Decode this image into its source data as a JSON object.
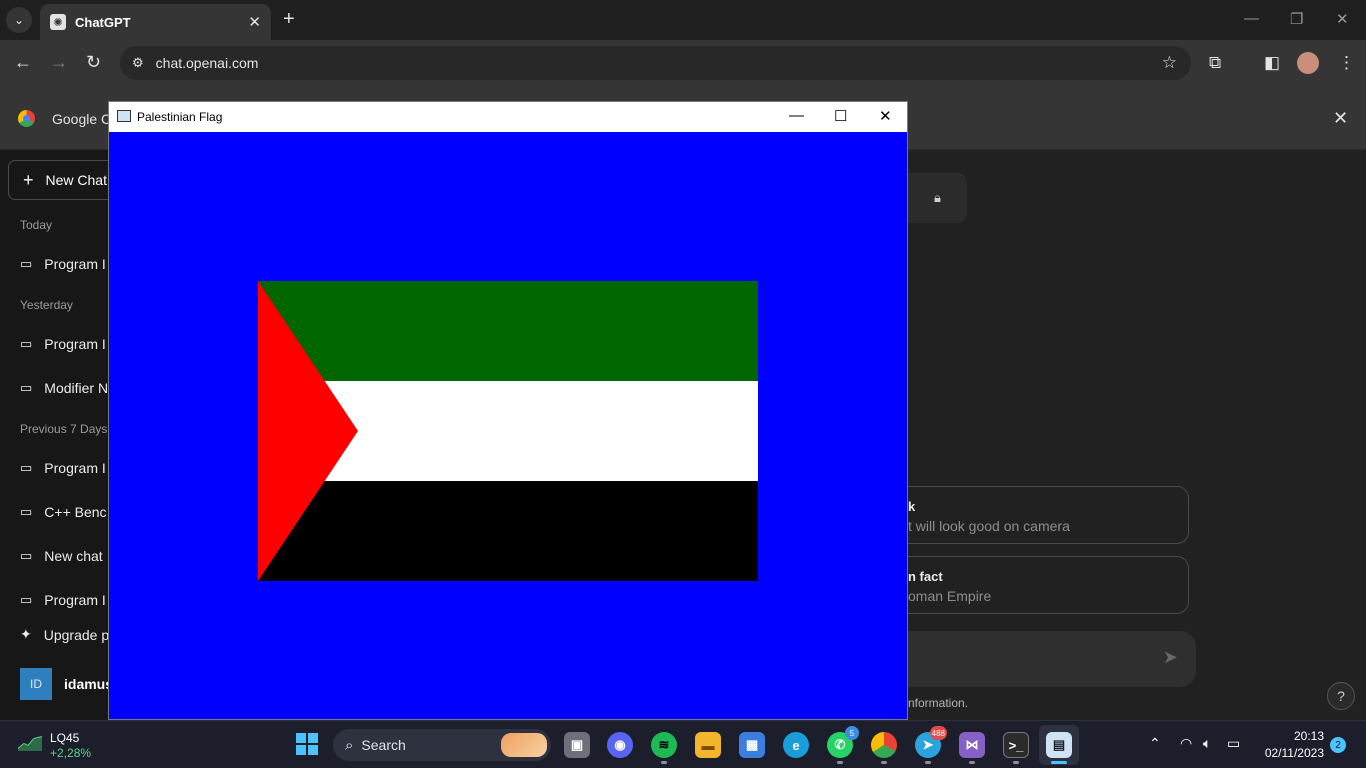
{
  "browser": {
    "tab": {
      "title": "ChatGPT",
      "favicon": "openai-icon"
    },
    "url": "chat.openai.com",
    "infobar": {
      "text": "Google Cl"
    }
  },
  "sidebar": {
    "new_chat": "New Chat",
    "sections": [
      {
        "label": "Today",
        "items": [
          "Program I"
        ]
      },
      {
        "label": "Yesterday",
        "items": [
          "Program I",
          "Modifier N"
        ]
      },
      {
        "label": "Previous 7 Days",
        "items": [
          "Program I",
          "C++ Benc",
          "New chat",
          "Program I"
        ]
      }
    ],
    "upgrade": "Upgrade p",
    "user": {
      "initials": "ID",
      "name": "idamus"
    }
  },
  "main": {
    "suggestions": [
      {
        "title": "k",
        "subtitle": "t will look good on camera"
      },
      {
        "title": "n fact",
        "subtitle": "oman Empire"
      }
    ],
    "disclaimer": "nformation.",
    "help": "?"
  },
  "flag_window": {
    "title": "Palestinian Flag",
    "colors": {
      "background": "#0000ff",
      "top": "#006600",
      "middle": "#ffffff",
      "bottom": "#000000",
      "triangle": "#ff0000"
    }
  },
  "taskbar": {
    "stock": {
      "name": "LQ45",
      "change": "+2,28%"
    },
    "search_label": "Search",
    "apps": [
      {
        "icon": "task-view-icon"
      },
      {
        "icon": "discord-icon"
      },
      {
        "icon": "spotify-icon"
      },
      {
        "icon": "file-explorer-icon"
      },
      {
        "icon": "ms-store-icon"
      },
      {
        "icon": "edge-icon"
      },
      {
        "icon": "whatsapp-icon",
        "badge": "5"
      },
      {
        "icon": "chrome-icon"
      },
      {
        "icon": "telegram-icon",
        "badge": "488"
      },
      {
        "icon": "visual-studio-icon"
      },
      {
        "icon": "terminal-icon"
      },
      {
        "icon": "flag-app-icon"
      }
    ],
    "time": "20:13",
    "date": "02/11/2023",
    "notifications": "2"
  }
}
